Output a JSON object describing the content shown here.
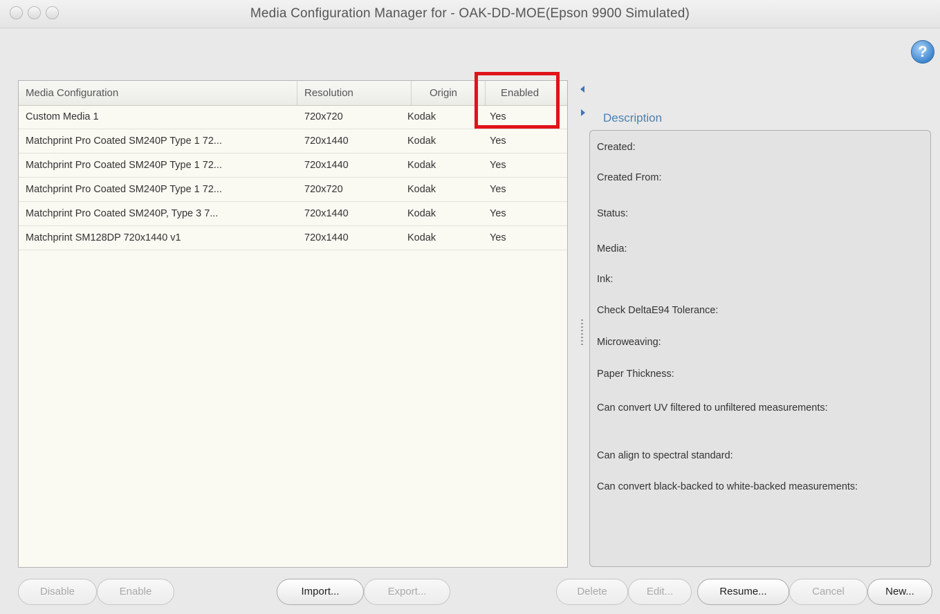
{
  "window": {
    "title": "Media Configuration Manager for - OAK-DD-MOE(Epson 9900 Simulated)",
    "help_glyph": "?"
  },
  "table": {
    "headers": [
      "Media Configuration",
      "Resolution",
      "Origin",
      "Enabled"
    ],
    "rows": [
      [
        "Custom Media 1",
        "720x720",
        "Kodak",
        "Yes"
      ],
      [
        "Matchprint Pro Coated SM240P Type 1 72...",
        "720x1440",
        "Kodak",
        "Yes"
      ],
      [
        "Matchprint Pro Coated SM240P Type 1 72...",
        "720x1440",
        "Kodak",
        "Yes"
      ],
      [
        "Matchprint Pro Coated SM240P Type 1 72...",
        "720x720",
        "Kodak",
        "Yes"
      ],
      [
        "Matchprint Pro Coated SM240P, Type 3 7...",
        "720x1440",
        "Kodak",
        "Yes"
      ],
      [
        "Matchprint SM128DP 720x1440 v1",
        "720x1440",
        "Kodak",
        "Yes"
      ]
    ]
  },
  "description": {
    "label": "Description",
    "fields": [
      "Created:",
      "Created From:",
      "Status:",
      "Media:",
      "Ink:",
      "Check DeltaE94 Tolerance:",
      "Microweaving:",
      "Paper Thickness:",
      "Can convert UV filtered to unfiltered measurements:",
      "Can align to spectral standard:",
      "Can convert black-backed to white-backed measurements:"
    ]
  },
  "buttons": {
    "disable": "Disable",
    "enable": "Enable",
    "import": "Import...",
    "export": "Export...",
    "delete": "Delete",
    "edit": "Edit...",
    "resume": "Resume...",
    "cancel": "Cancel",
    "new": "New..."
  },
  "colors": {
    "highlight": "#e0131b",
    "description_label": "#4d7fae",
    "help_icon": "#3f86cf"
  }
}
